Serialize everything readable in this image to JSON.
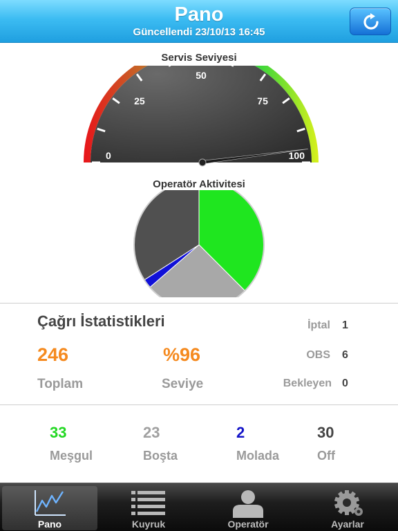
{
  "header": {
    "title": "Pano",
    "subtitle": "Güncellendi 23/10/13 16:45",
    "refresh_icon": "refresh-icon"
  },
  "gauge": {
    "title": "Servis Seviyesi",
    "ticks": [
      "0",
      "25",
      "50",
      "75",
      "100"
    ],
    "min": 0,
    "max": 100,
    "value": 96,
    "colors": {
      "low": "#e8141a",
      "mid": "#6fc33a",
      "high": "#d8f01c",
      "face": "#4a4a4a",
      "needle": "#222222"
    }
  },
  "chart_data": {
    "type": "pie",
    "title": "Operatör Aktivitesi",
    "slices": [
      {
        "name": "Meşgul",
        "value": 33,
        "color": "#1fe61f"
      },
      {
        "name": "Boşta",
        "value": 23,
        "color": "#a8a8a8"
      },
      {
        "name": "Molada",
        "value": 2,
        "color": "#1010d8"
      },
      {
        "name": "Off",
        "value": 30,
        "color": "#505050"
      }
    ]
  },
  "call_stats": {
    "title": "Çağrı İstatistikleri",
    "total_value": "246",
    "total_label": "Toplam",
    "level_value": "%96",
    "level_label": "Seviye",
    "side": [
      {
        "label": "İptal",
        "value": "1"
      },
      {
        "label": "OBS",
        "value": "6"
      },
      {
        "label": "Bekleyen",
        "value": "0"
      }
    ]
  },
  "operators": [
    {
      "value": "33",
      "label": "Meşgul",
      "color": "#22d822"
    },
    {
      "value": "23",
      "label": "Boşta",
      "color": "#a0a0a0"
    },
    {
      "value": "2",
      "label": "Molada",
      "color": "#1414c8"
    },
    {
      "value": "30",
      "label": "Off",
      "color": "#444444"
    }
  ],
  "tabs": [
    {
      "label": "Pano",
      "icon": "chart-line-icon",
      "active": true
    },
    {
      "label": "Kuyruk",
      "icon": "list-icon",
      "active": false
    },
    {
      "label": "Operatör",
      "icon": "person-icon",
      "active": false
    },
    {
      "label": "Ayarlar",
      "icon": "gear-icon",
      "active": false
    }
  ]
}
